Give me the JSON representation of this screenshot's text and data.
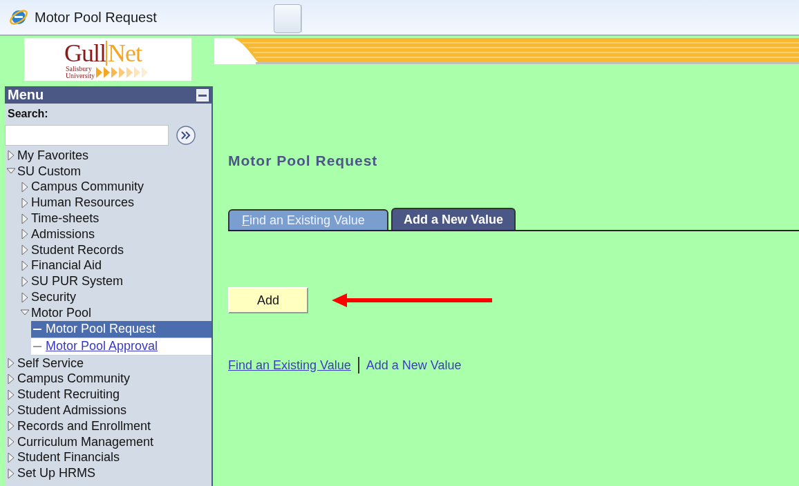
{
  "window": {
    "title": "Motor Pool Request"
  },
  "logo": {
    "primary": "Gull",
    "secondary": "Net",
    "institution": [
      "Salisbury",
      "University"
    ]
  },
  "menu": {
    "title": "Menu",
    "search_label": "Search:",
    "items": [
      {
        "label": "My Favorites",
        "kind": "folder",
        "expanded": false
      },
      {
        "label": "SU Custom",
        "kind": "folder",
        "expanded": true,
        "children": [
          {
            "label": "Campus Community",
            "kind": "folder",
            "expanded": false
          },
          {
            "label": "Human Resources",
            "kind": "folder",
            "expanded": false
          },
          {
            "label": "Time-sheets",
            "kind": "folder",
            "expanded": false
          },
          {
            "label": "Admissions",
            "kind": "folder",
            "expanded": false
          },
          {
            "label": "Student Records",
            "kind": "folder",
            "expanded": false
          },
          {
            "label": "Financial Aid",
            "kind": "folder",
            "expanded": false
          },
          {
            "label": "SU PUR System",
            "kind": "folder",
            "expanded": false
          },
          {
            "label": "Security",
            "kind": "folder",
            "expanded": false
          },
          {
            "label": "Motor Pool",
            "kind": "folder",
            "expanded": true,
            "children": [
              {
                "label": "Motor Pool Request",
                "kind": "leaf",
                "selected": true
              },
              {
                "label": "Motor Pool Approval",
                "kind": "leaf",
                "selected": false
              }
            ]
          }
        ]
      },
      {
        "label": "Self Service",
        "kind": "folder",
        "expanded": false
      },
      {
        "label": "Campus Community",
        "kind": "folder",
        "expanded": false
      },
      {
        "label": "Student Recruiting",
        "kind": "folder",
        "expanded": false
      },
      {
        "label": "Student Admissions",
        "kind": "folder",
        "expanded": false
      },
      {
        "label": "Records and Enrollment",
        "kind": "folder",
        "expanded": false
      },
      {
        "label": "Curriculum Management",
        "kind": "folder",
        "expanded": false
      },
      {
        "label": "Student Financials",
        "kind": "folder",
        "expanded": false
      },
      {
        "label": "Set Up HRMS",
        "kind": "folder",
        "expanded": false
      }
    ]
  },
  "page": {
    "title": "Motor Pool Request",
    "tabs": [
      {
        "label": "Find an Existing Value",
        "selected": false
      },
      {
        "label": "Add a New Value",
        "selected": true
      }
    ],
    "add_button": "Add",
    "links": [
      {
        "label": "Find an Existing Value",
        "underlined": true
      },
      {
        "label": "Add a New Value",
        "underlined": false
      }
    ]
  }
}
